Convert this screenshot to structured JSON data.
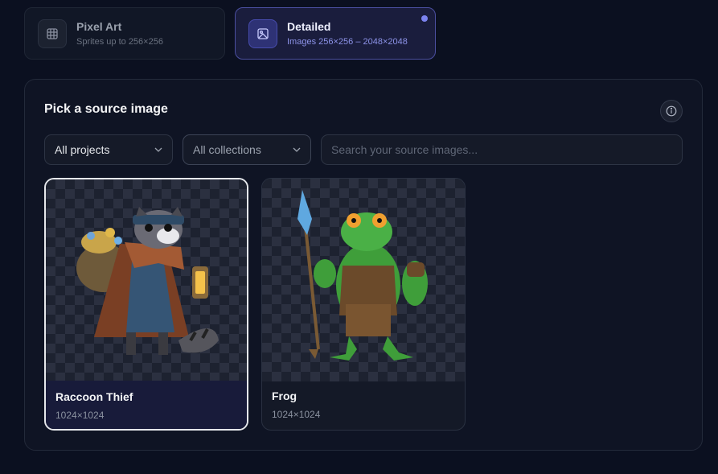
{
  "modes": [
    {
      "title": "Pixel Art",
      "subtitle": "Sprites up to 256×256",
      "icon": "grid-icon"
    },
    {
      "title": "Detailed",
      "subtitle": "Images 256×256 – 2048×2048",
      "icon": "image-icon"
    }
  ],
  "panel": {
    "title": "Pick a source image",
    "info_icon": "info-icon"
  },
  "filters": {
    "projects": "All projects",
    "collections": "All collections",
    "search_placeholder": "Search your source images...",
    "search_value": ""
  },
  "images": [
    {
      "name": "Raccoon Thief",
      "dims": "1024×1024"
    },
    {
      "name": "Frog",
      "dims": "1024×1024"
    }
  ],
  "colors": {
    "accent": "#7c83f0",
    "background": "#0b1020",
    "panel": "#0f1424"
  }
}
